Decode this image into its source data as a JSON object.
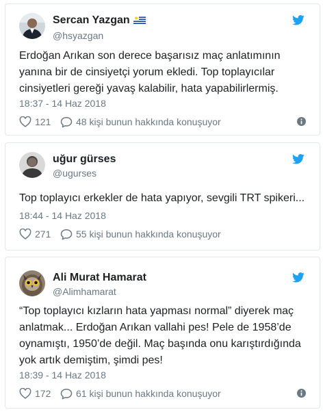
{
  "colors": {
    "twitter_blue": "#1da1f2",
    "text": "#1c2022",
    "muted": "#697882",
    "border": "#e1e8ed"
  },
  "tweets": [
    {
      "display_name": "Sercan Yazgan",
      "flag_icon": "uruguay-flag-icon",
      "handle": "@hsyazgan",
      "text_lines": [
        "Erdoğan Arıkan son derece başarısız maç anlatımının",
        "yanına bir de cinsiyetçi yorum ekledi. Top toplayıcılar",
        "cinsiyetleri gereği yavaş kalabilir, hata yapabilirlermiş."
      ],
      "timestamp": "18:37 - 14 Haz 2018",
      "likes": "121",
      "replies_text": "48 kişi bunun hakkında konuşuyor"
    },
    {
      "display_name": "uğur gürses",
      "handle": "@ugurses",
      "text_lines": [
        "Top toplayıcı erkekler de hata yapıyor, sevgili TRT spikeri..."
      ],
      "timestamp": "18:44 - 14 Haz 2018",
      "likes": "271",
      "replies_text": "55 kişi bunun hakkında konuşuyor"
    },
    {
      "display_name": "Ali Murat Hamarat",
      "handle": "@Alimhamarat",
      "text_lines": [
        "“Top toplayıcı kızların hata yapması normal” diyerek maç",
        "anlatmak... Erdoğan Arıkan vallahi pes! Pele de 1958’de",
        "oynamıştı, 1950’de değil. Maç başında onu karıştırdığında",
        "yok artık demiştim, şimdi pes!"
      ],
      "timestamp": "18:39 - 14 Haz 2018",
      "likes": "172",
      "replies_text": "61 kişi bunun hakkında konuşuyor"
    }
  ]
}
